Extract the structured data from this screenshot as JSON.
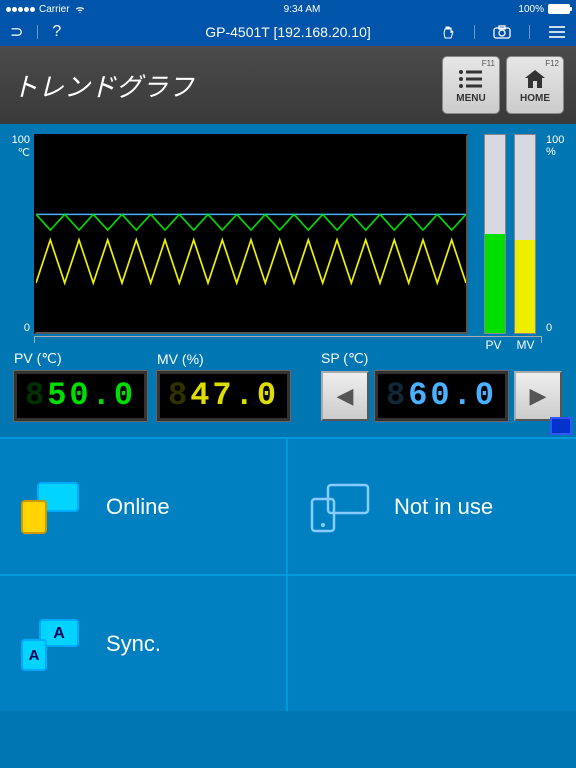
{
  "status_bar": {
    "carrier": "Carrier",
    "time": "9:34 AM",
    "battery_pct": "100%"
  },
  "nav": {
    "title": "GP-4501T [192.168.20.10]"
  },
  "header": {
    "title": "トレンドグラフ",
    "menu_btn": {
      "f": "F11",
      "label": "MENU"
    },
    "home_btn": {
      "f": "F12",
      "label": "HOME"
    }
  },
  "axes": {
    "left_top_val": "100",
    "left_top_unit": "℃",
    "left_bot": "0",
    "right_top_val": "100",
    "right_top_unit": "%",
    "right_bot": "0"
  },
  "bars": {
    "pv_label": "PV",
    "mv_label": "MV",
    "pv_pct": 50,
    "mv_pct": 47
  },
  "readouts": {
    "pv": {
      "label": "PV (℃)",
      "value": "50.0"
    },
    "mv": {
      "label": "MV (%)",
      "value": "47.0"
    },
    "sp": {
      "label": "SP (℃)",
      "value": "60.0"
    }
  },
  "tiles": {
    "online": "Online",
    "notinuse": "Not in use",
    "sync": "Sync."
  },
  "chart_data": {
    "type": "line",
    "title": "トレンドグラフ",
    "ylabel_left": "℃",
    "ylim_left": [
      0,
      100
    ],
    "ylabel_right": "%",
    "ylim_right": [
      0,
      100
    ],
    "series": [
      {
        "name": "PV",
        "unit": "℃",
        "color": "#00e000",
        "values": [
          60,
          52,
          60,
          52,
          60,
          52,
          60,
          52,
          60,
          52,
          60,
          52,
          60,
          52,
          60,
          52,
          60,
          52,
          60,
          52,
          60,
          52,
          60,
          52,
          60,
          52,
          60,
          52,
          60,
          52,
          60
        ]
      },
      {
        "name": "MV",
        "unit": "%",
        "color": "#eeee00",
        "values": [
          25,
          47,
          25,
          47,
          25,
          47,
          25,
          47,
          25,
          47,
          25,
          47,
          25,
          47,
          25,
          47,
          25,
          47,
          25,
          47,
          25,
          47,
          25,
          47,
          25,
          47,
          25,
          47,
          25,
          47,
          25
        ]
      }
    ],
    "sp_line": {
      "name": "SP",
      "value": 60,
      "color": "#4ab0ff"
    }
  }
}
